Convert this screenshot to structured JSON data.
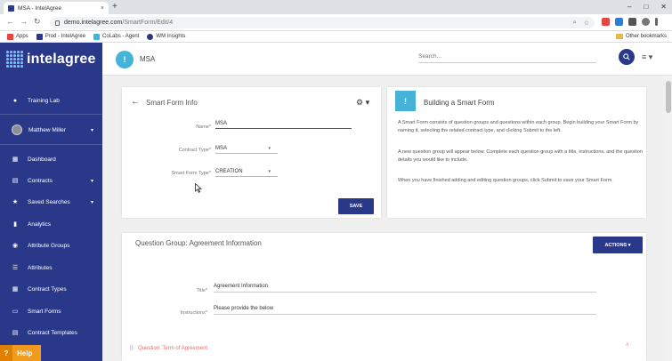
{
  "browser": {
    "tab_title": "MSA - IntelAgree",
    "tab_close": "×",
    "new_tab": "+",
    "url_host": "demo.intelagree.com",
    "url_path": "/SmartForm/Edit/4",
    "bookmarks": [
      "Apps",
      "Prod - IntelAgree",
      "CoLabs - Agent",
      "WM Insights"
    ],
    "bookmark_colors": [
      "#e8453c",
      "#2a3889",
      "#45b3d8",
      "#2a3889"
    ],
    "other_bookmarks": "Other bookmarks"
  },
  "sidebar": {
    "brand": "intelagree",
    "items": [
      {
        "label": "Training Lab",
        "icon": "map-pin-icon",
        "glyph": "●"
      },
      {
        "label": "Matthew Miller",
        "icon": "avatar",
        "caret": "▾"
      },
      {
        "label": "Dashboard",
        "icon": "dashboard-icon",
        "glyph": "▦"
      },
      {
        "label": "Contracts",
        "icon": "document-icon",
        "glyph": "▤",
        "caret": "▾"
      },
      {
        "label": "Saved Searches",
        "icon": "star-icon",
        "glyph": "★",
        "caret": "▾"
      },
      {
        "label": "Analytics",
        "icon": "chart-icon",
        "glyph": "▮"
      },
      {
        "label": "Attribute Groups",
        "icon": "palette-icon",
        "glyph": "◉"
      },
      {
        "label": "Attributes",
        "icon": "list-icon",
        "glyph": "☰"
      },
      {
        "label": "Contract Types",
        "icon": "grid-icon",
        "glyph": "▦"
      },
      {
        "label": "Smart Forms",
        "icon": "form-icon",
        "glyph": "▭"
      },
      {
        "label": "Contract Templates",
        "icon": "template-icon",
        "glyph": "▤"
      }
    ],
    "help": {
      "glyph": "?",
      "label": "Help"
    }
  },
  "header": {
    "circle_glyph": "!",
    "title": "MSA",
    "search_placeholder": "Search...",
    "menu_glyph": "≡ ▾"
  },
  "form": {
    "title": "Smart Form Info",
    "back_glyph": "←",
    "gear_glyph": "⚙ ▾",
    "fields": [
      {
        "label": "Name*",
        "value": "MSA"
      },
      {
        "label": "Contract Type*",
        "value": "MSA",
        "caret": "▾"
      },
      {
        "label": "Smart Form Type*",
        "value": "CREATION",
        "caret": "▾"
      }
    ],
    "save_label": "SAVE"
  },
  "info": {
    "glyph": "!",
    "title": "Building a Smart Form",
    "paragraphs": [
      "A Smart Form consists of question groups and questions within each group. Begin building your Smart Form by naming it, selecting the related contract type, and clicking Submit to the left.",
      "A new question group will appear below. Complete each question group with a title, instructions, and the question details you would like to include.",
      "When you have finished adding and editing question groups, click Submit to save your Smart Form."
    ]
  },
  "question_group": {
    "title": "Question Group: Agreement Information",
    "actions_label": "ACTIONS ▾",
    "fields": [
      {
        "label": "Title*",
        "value": "Agreement Information"
      },
      {
        "label": "Instructions*",
        "value": "Please provide the below"
      }
    ],
    "question": "Question: Term of Agreement",
    "question_grip": "⠿",
    "question_chevron": "^"
  },
  "colors": {
    "sidebar": "#2a3889",
    "accent": "#45b3d8",
    "button": "#2a3889",
    "help": "#f29a1e",
    "question": "#e07070"
  }
}
